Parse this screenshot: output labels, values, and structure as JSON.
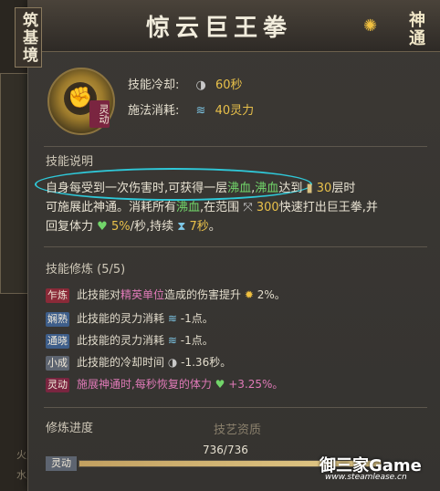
{
  "header": {
    "realm": "筑基境",
    "title": "惊云巨王拳",
    "brand": "神通"
  },
  "skill": {
    "icon_tag": "灵动",
    "cooldown_label": "技能冷却:",
    "cooldown_value": "60秒",
    "cost_label": "施法消耗:",
    "cost_value": "40灵力"
  },
  "description": {
    "section_title": "技能说明",
    "line1_a": "自身每受到一次伤害时,可获得一层",
    "line1_b": "沸血",
    "line1_c": ",",
    "line1_d": "沸血",
    "line1_e": "达到",
    "line1_f": "30",
    "line1_g": "层时",
    "line2_a": "可施展此神通。消耗所有",
    "line2_b": "沸血",
    "line2_c": ",在范围",
    "line2_d": "300",
    "line2_e": "快速打出巨王拳,并",
    "line3_a": "回复体力",
    "line3_b": "5%",
    "line3_c": "/秒,持续",
    "line3_d": "7秒",
    "line3_e": "。"
  },
  "training": {
    "section_title": "技能修炼 (5/5)",
    "rows": [
      {
        "tag": "乍炼",
        "a": "此技能对",
        "b": "精英单位",
        "c": "造成的伤害提升",
        "d": "2%。"
      },
      {
        "tag": "娴熟",
        "a": "此技能的灵力消耗",
        "b": "",
        "c": "",
        "d": "-1点。"
      },
      {
        "tag": "通晓",
        "a": "此技能的灵力消耗",
        "b": "",
        "c": "",
        "d": "-1点。"
      },
      {
        "tag": "小成",
        "a": "此技能的冷却时间",
        "b": "",
        "c": "",
        "d": "-1.36秒。"
      },
      {
        "tag": "灵动",
        "a": "施展神通时,每秒恢复的体力",
        "b": "",
        "c": "",
        "d": "+3.25%。"
      }
    ]
  },
  "progress": {
    "label": "修炼进度",
    "count": "736/736",
    "fraction": 1.0,
    "badge": "灵动"
  },
  "background": {
    "text1": "技艺资质",
    "text2": "火灵根",
    "text3": "水灵根",
    "text4": "灵"
  },
  "watermark": {
    "brand": "御三家Game",
    "site": "www.steamlease.cn"
  }
}
